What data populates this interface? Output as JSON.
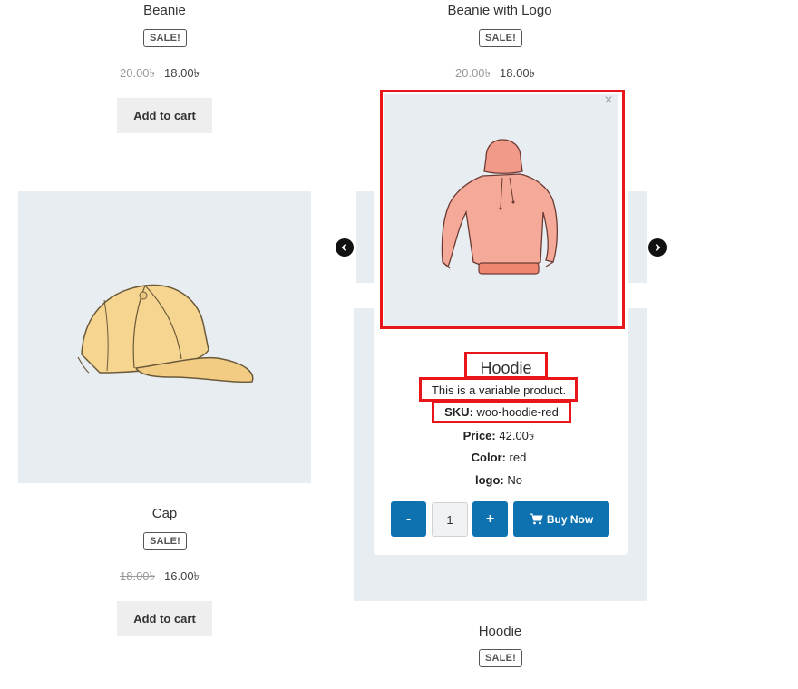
{
  "products": {
    "beanie": {
      "title": "Beanie",
      "badge": "SALE!",
      "old_price": "20.00৳",
      "new_price": "18.00৳",
      "button": "Add to cart"
    },
    "beanie_logo": {
      "title": "Beanie with Logo",
      "badge": "SALE!",
      "old_price": "20.00৳",
      "new_price": "18.00৳"
    },
    "cap": {
      "title": "Cap",
      "badge": "SALE!",
      "old_price": "18.00৳",
      "new_price": "16.00৳",
      "button": "Add to cart"
    },
    "hoodie": {
      "title": "Hoodie",
      "badge": "SALE!"
    }
  },
  "popup": {
    "close": "×",
    "title": "Hoodie",
    "description": "This is a variable product.",
    "sku_label": "SKU:",
    "sku_value": "woo-hoodie-red",
    "price_label": "Price:",
    "price_value": "42.00৳",
    "color_label": "Color:",
    "color_value": "red",
    "logo_label": "logo:",
    "logo_value": "No",
    "qty_minus": "-",
    "qty_value": "1",
    "qty_plus": "+",
    "buy_label": "Buy Now"
  },
  "colors": {
    "accent": "#0e72b1",
    "highlight": "#e8161b",
    "panel": "#e8edf2"
  }
}
